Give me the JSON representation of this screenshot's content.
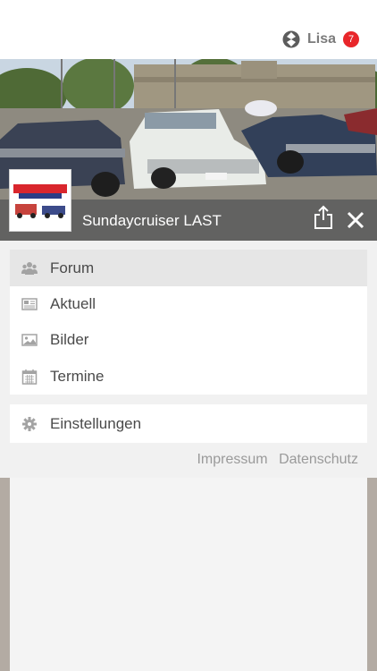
{
  "header": {
    "user_name": "Lisa",
    "notification_count": "7",
    "brand_icon": "app-logo-icon"
  },
  "group": {
    "name": "Sundaycruiser LAST",
    "logo_text": "SUNDAYCRUISER LAST",
    "share_icon": "share-icon",
    "close_icon": "close-icon"
  },
  "menu": {
    "items": [
      {
        "label": "Forum",
        "icon": "forum-people-icon",
        "active": true
      },
      {
        "label": "Aktuell",
        "icon": "news-icon"
      },
      {
        "label": "Bilder",
        "icon": "image-icon"
      },
      {
        "label": "Termine",
        "icon": "calendar-icon"
      }
    ],
    "settings": {
      "label": "Einstellungen",
      "icon": "gear-icon"
    }
  },
  "footer": {
    "impressum": "Impressum",
    "datenschutz": "Datenschutz"
  },
  "colors": {
    "badge": "#e8262a",
    "hero_bar": "#5f5f5f",
    "active_item": "#e6e6e6"
  }
}
